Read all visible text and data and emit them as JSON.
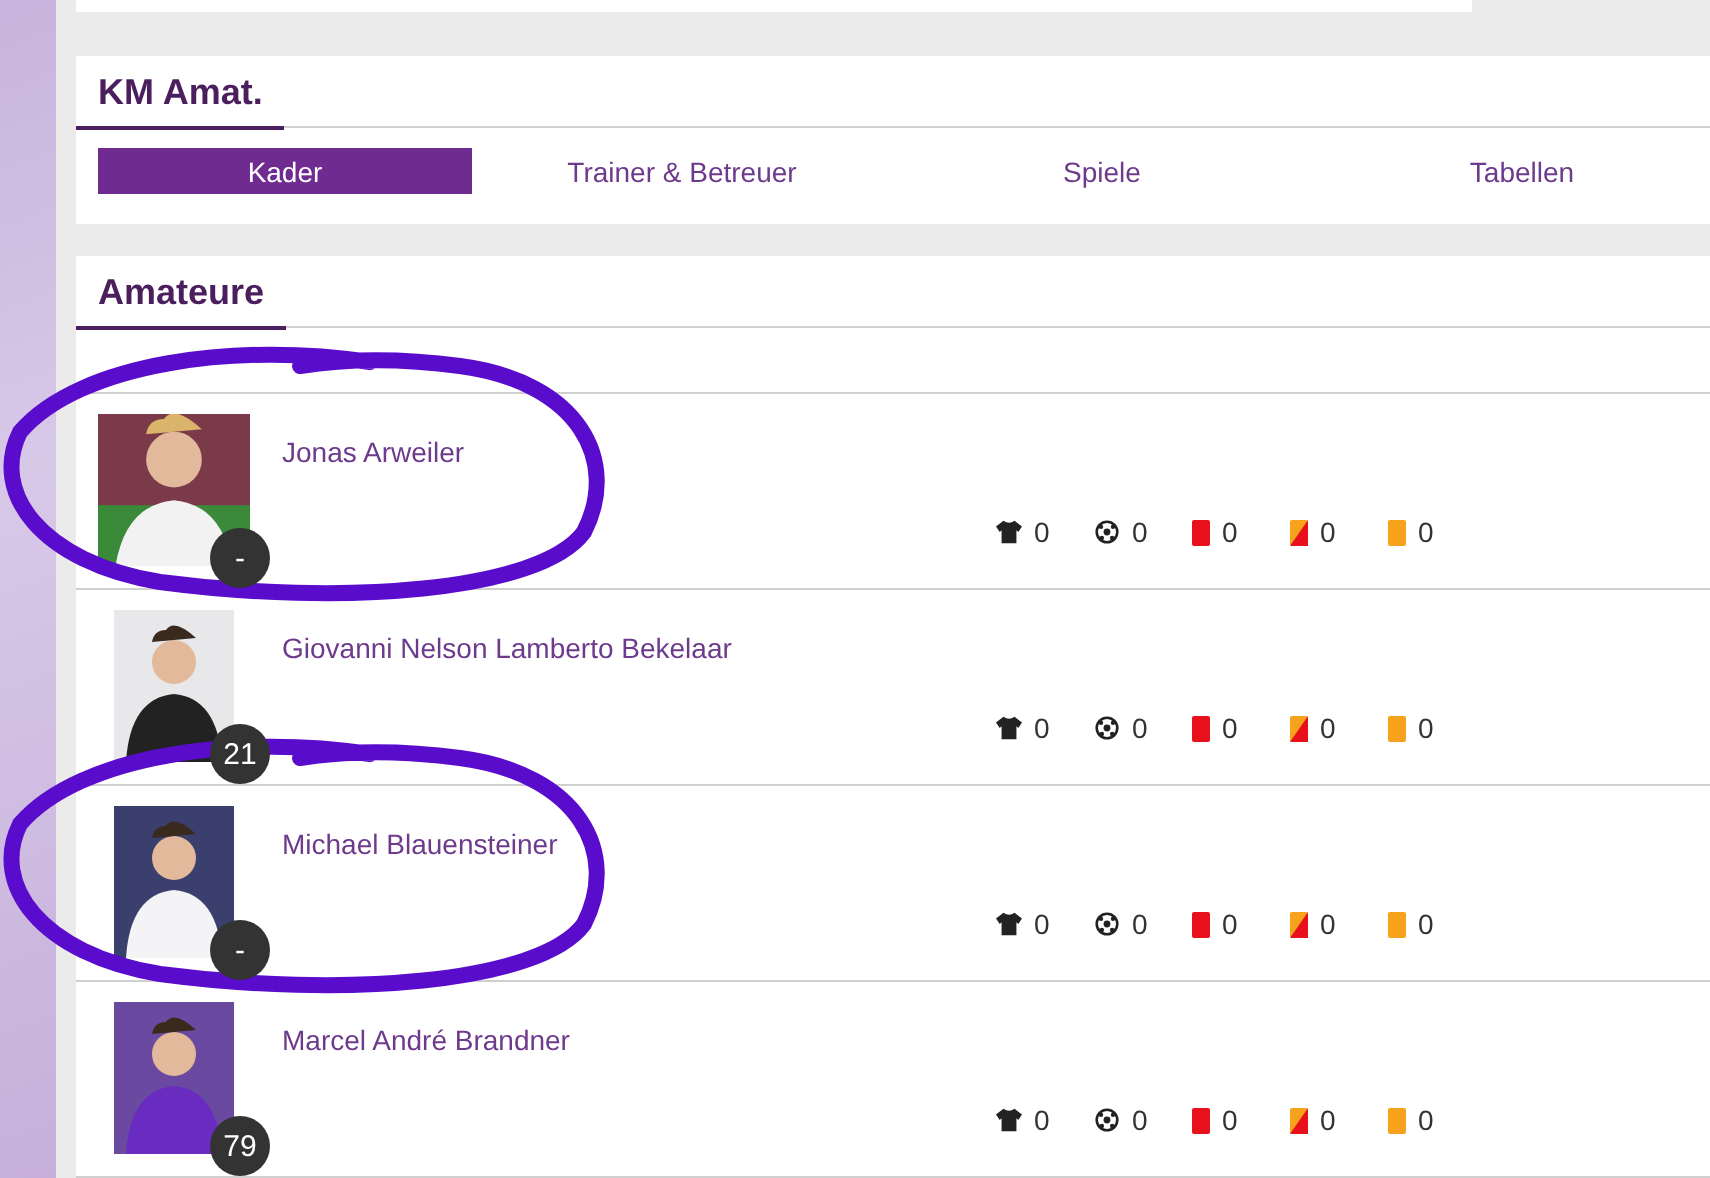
{
  "team": {
    "title": "KM Amat."
  },
  "tabs": [
    {
      "label": "Kader",
      "selected": true
    },
    {
      "label": "Trainer & Betreuer",
      "selected": false
    },
    {
      "label": "Spiele",
      "selected": false
    },
    {
      "label": "Tabellen",
      "selected": false
    }
  ],
  "section": {
    "title": "Amateure"
  },
  "players": [
    {
      "name": "Jonas Arweiler",
      "number": "-",
      "circled": true,
      "stats": [
        {
          "kind": "games",
          "value": "0"
        },
        {
          "kind": "goals",
          "value": "0"
        },
        {
          "kind": "red",
          "value": "0"
        },
        {
          "kind": "yellow-red",
          "value": "0"
        },
        {
          "kind": "yellow",
          "value": "0"
        }
      ]
    },
    {
      "name": "Giovanni Nelson Lamberto Bekelaar",
      "number": "21",
      "circled": false,
      "stats": [
        {
          "kind": "games",
          "value": "0"
        },
        {
          "kind": "goals",
          "value": "0"
        },
        {
          "kind": "red",
          "value": "0"
        },
        {
          "kind": "yellow-red",
          "value": "0"
        },
        {
          "kind": "yellow",
          "value": "0"
        }
      ]
    },
    {
      "name": "Michael Blauensteiner",
      "number": "-",
      "circled": true,
      "stats": [
        {
          "kind": "games",
          "value": "0"
        },
        {
          "kind": "goals",
          "value": "0"
        },
        {
          "kind": "red",
          "value": "0"
        },
        {
          "kind": "yellow-red",
          "value": "0"
        },
        {
          "kind": "yellow",
          "value": "0"
        }
      ]
    },
    {
      "name": "Marcel André Brandner",
      "number": "79",
      "circled": false,
      "stats": [
        {
          "kind": "games",
          "value": "0"
        },
        {
          "kind": "goals",
          "value": "0"
        },
        {
          "kind": "red",
          "value": "0"
        },
        {
          "kind": "yellow-red",
          "value": "0"
        },
        {
          "kind": "yellow",
          "value": "0"
        }
      ]
    }
  ]
}
